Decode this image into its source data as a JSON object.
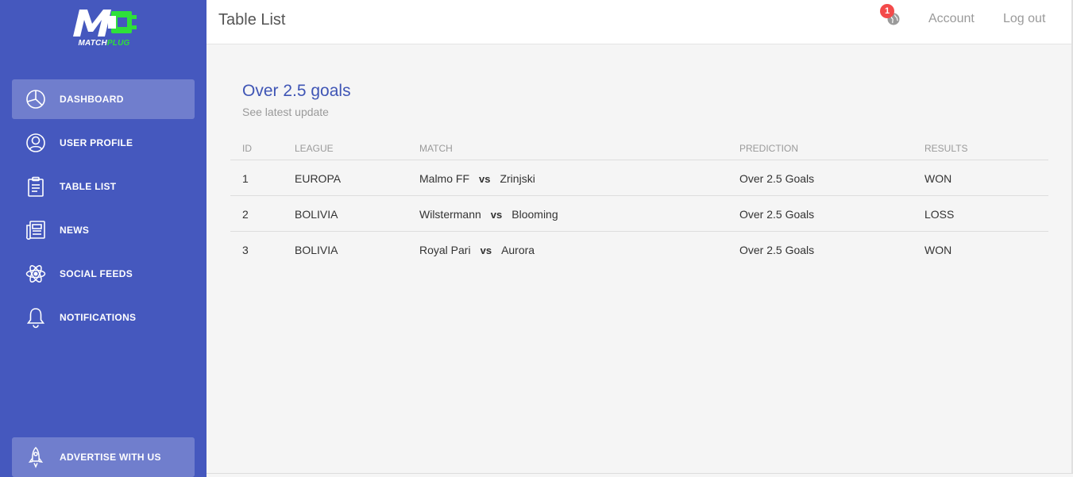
{
  "brand": {
    "logo_text_white": "MATCH",
    "logo_text_green": "PLUG",
    "accent_color": "#2ee03a",
    "sidebar_color": "#4558be"
  },
  "sidebar": {
    "items": [
      {
        "label": "DASHBOARD",
        "icon": "pie-chart-icon",
        "active": true
      },
      {
        "label": "USER PROFILE",
        "icon": "user-circle-icon"
      },
      {
        "label": "TABLE LIST",
        "icon": "clipboard-icon"
      },
      {
        "label": "NEWS",
        "icon": "newspaper-icon"
      },
      {
        "label": "SOCIAL FEEDS",
        "icon": "atom-icon"
      },
      {
        "label": "NOTIFICATIONS",
        "icon": "bell-icon"
      }
    ],
    "bottom_item": {
      "label": "ADVERTISE WITH US",
      "icon": "rocket-icon"
    }
  },
  "topbar": {
    "title": "Table List",
    "notification_count": "1",
    "notification_icon": "globe-icon",
    "account_label": "Account",
    "logout_label": "Log out"
  },
  "card": {
    "title": "Over 2.5 goals",
    "subtitle": "See latest update"
  },
  "table": {
    "columns": [
      "ID",
      "LEAGUE",
      "MATCH",
      "PREDICTION",
      "RESULTS"
    ],
    "vs_label": "vs",
    "rows": [
      {
        "id": "1",
        "league": "EUROPA",
        "home": "Malmo FF",
        "away": "Zrinjski",
        "prediction": "Over 2.5 Goals",
        "result": "WON"
      },
      {
        "id": "2",
        "league": "BOLIVIA",
        "home": "Wilstermann",
        "away": "Blooming",
        "prediction": "Over 2.5 Goals",
        "result": "LOSS"
      },
      {
        "id": "3",
        "league": "BOLIVIA",
        "home": "Royal Pari",
        "away": "Aurora",
        "prediction": "Over 2.5 Goals",
        "result": "WON"
      }
    ]
  }
}
